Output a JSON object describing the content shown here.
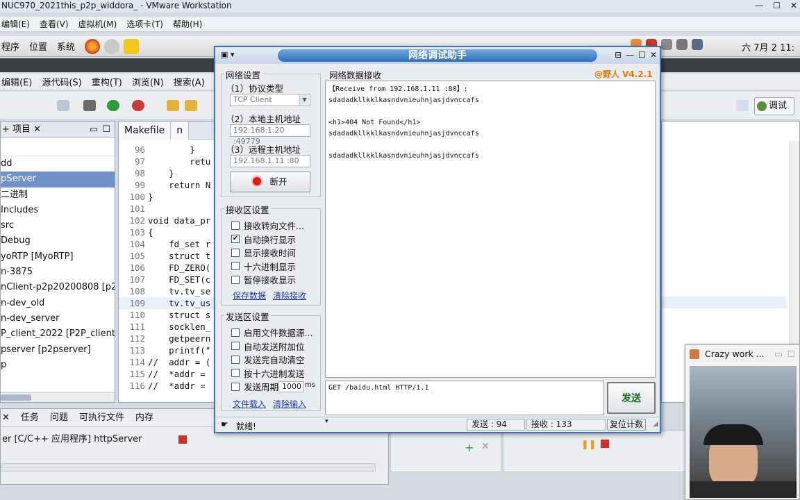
{
  "vmware": {
    "title": "NUC970_2021this_p2p_widdora_ - VMware Workstation",
    "menu": [
      "编辑(E)",
      "查看(V)",
      "虚拟机(M)",
      "选项卡(T)",
      "帮助(H)"
    ]
  },
  "gnome_panel": {
    "menus": [
      "程序",
      "位置",
      "系统"
    ],
    "clock": "六 7月  2 11:"
  },
  "eclipse": {
    "menu": [
      "编辑(E)",
      "源代码(S)",
      "重构(T)",
      "浏览(N)",
      "搜索(A)"
    ],
    "debug_perspective": "调试",
    "project_explorer": {
      "title": "项目",
      "items": [
        "dd",
        "pServer",
        "二进制",
        "Includes",
        "src",
        "Debug",
        "yoRTP [MyoRTP]",
        "n-3875",
        "nClient-p2p20200808 [p2",
        "n-dev_old",
        "n-dev_server",
        "P_client_2022 [P2P_client",
        "pserver [p2pserver]",
        "p"
      ],
      "selected_index": 1
    },
    "editor_tabs": [
      "Makefile",
      "n"
    ],
    "code_lines": [
      {
        "n": "96",
        "t": "        }"
      },
      {
        "n": "97",
        "t": "        retu"
      },
      {
        "n": "98",
        "t": "    }"
      },
      {
        "n": "99",
        "t": "    return N"
      },
      {
        "n": "100",
        "t": "}"
      },
      {
        "n": "101",
        "t": ""
      },
      {
        "n": "102",
        "t": "void data_pr"
      },
      {
        "n": "103",
        "t": "{"
      },
      {
        "n": "104",
        "t": "    fd_set r"
      },
      {
        "n": "105",
        "t": "    struct t"
      },
      {
        "n": "106",
        "t": "    FD_ZERO("
      },
      {
        "n": "107",
        "t": "    FD_SET(c"
      },
      {
        "n": "108",
        "t": "    tv.tv_se"
      },
      {
        "n": "109",
        "t": "    tv.tv_us"
      },
      {
        "n": "110",
        "t": "    struct s"
      },
      {
        "n": "111",
        "t": "    socklen_"
      },
      {
        "n": "112",
        "t": "    getpeern"
      },
      {
        "n": "113",
        "t": "    printf(\""
      },
      {
        "n": "114",
        "t": "//  addr = ("
      },
      {
        "n": "115",
        "t": "//  *addr ="
      },
      {
        "n": "116",
        "t": "//  *addr ="
      }
    ],
    "bottom_tabs": [
      "任务",
      "问题",
      "可执行文件",
      "内存"
    ],
    "console_line": "er [C/C++ 应用程序] httpServer"
  },
  "net_tool": {
    "title": "网络调试助手",
    "version": "@野人 V4.2.1",
    "net_settings": {
      "group": "网络设置",
      "protocol_label": "（1）协议类型",
      "protocol_value": "TCP Client",
      "local_label": "（2）本地主机地址",
      "local_value": "192.168.1.20 :49779",
      "remote_label": "（3）远程主机地址",
      "remote_value": "192.168.1.11 :80",
      "disconnect_label": "断开"
    },
    "recv_settings": {
      "group": "接收区设置",
      "options": [
        {
          "label": "接收转向文件...",
          "checked": false
        },
        {
          "label": "自动换行显示",
          "checked": true
        },
        {
          "label": "显示接收时间",
          "checked": false
        },
        {
          "label": "十六进制显示",
          "checked": false
        },
        {
          "label": "暂停接收显示",
          "checked": false
        }
      ],
      "save_link": "保存数据",
      "clear_link": "清除接收"
    },
    "send_settings": {
      "group": "发送区设置",
      "options": [
        {
          "label": "启用文件数据源...",
          "checked": false
        },
        {
          "label": "自动发送附加位",
          "checked": false
        },
        {
          "label": "发送完自动清空",
          "checked": false
        },
        {
          "label": "按十六进制发送",
          "checked": false
        },
        {
          "label": "发送周期",
          "checked": false
        }
      ],
      "period_value": "1000",
      "period_unit": "ms",
      "load_link": "文件载入",
      "clear_input_link": "清除输入"
    },
    "recv_area": {
      "label": "网络数据接收",
      "text": "【Receive from 192.168.1.11 :80】:\nsdadadkllkklkasndvnieuhnjasjdvnccafs\n\n<h1>404 Not Found</h1>\nsdadadkllkklkasndvnieuhnjasjdvnccafs\n\nsdadadkllkklkasndvnieuhnjasjdvnccafs"
    },
    "send_area": {
      "text": "GET /baidu.html HTTP/1.1"
    },
    "send_button": "发送",
    "status": {
      "ready": "就绪!",
      "sent": "发送 : 94",
      "received": "接收 : 133",
      "reset": "复位计数"
    }
  },
  "webcam": {
    "title": "Crazy work ..."
  }
}
